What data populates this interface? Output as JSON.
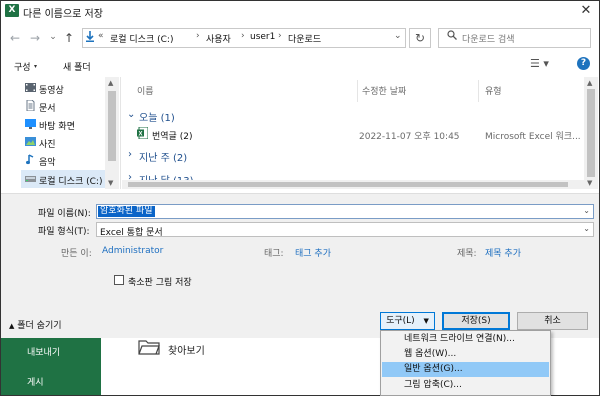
{
  "window": {
    "title": "다른 이름으로 저장",
    "app_icon": "X",
    "close_glyph": "✕"
  },
  "nav": {
    "back": "←",
    "forward": "→",
    "dropdown": "⌄",
    "up": "↑",
    "addr_prefix": "«",
    "breadcrumbs": [
      "로컬 디스크 (C:)",
      "사용자",
      "user1",
      "다운로드"
    ],
    "sep": "›",
    "refresh": "↻",
    "search_placeholder": "다운로드 검색"
  },
  "toolbar": {
    "organize": "구성",
    "new_folder": "새 폴더",
    "view_glyph": "☰ ▾",
    "help": "?"
  },
  "sidebar": {
    "items": [
      {
        "label": "동영상",
        "icon": "video-icon"
      },
      {
        "label": "문서",
        "icon": "document-icon"
      },
      {
        "label": "바탕 화면",
        "icon": "desktop-icon"
      },
      {
        "label": "사진",
        "icon": "picture-icon"
      },
      {
        "label": "음악",
        "icon": "music-icon"
      },
      {
        "label": "로컬 디스크 (C:)",
        "icon": "drive-icon"
      }
    ]
  },
  "filelist": {
    "columns": [
      "이름",
      "수정한 날짜",
      "유형"
    ],
    "groups": [
      {
        "label": "오늘 (1)",
        "expanded": true
      },
      {
        "label": "지난 주 (2)",
        "expanded": false
      },
      {
        "label": "지난 달 (13)",
        "expanded": false
      }
    ],
    "files": [
      {
        "name": "번역글 (2)",
        "modified": "2022-11-07 오후 10:45",
        "type": "Microsoft Excel 워크..."
      }
    ]
  },
  "form": {
    "filename_label": "파일 이름(N):",
    "filename_value": "암호화된 파일",
    "filetype_label": "파일 형식(T):",
    "filetype_value": "Excel 통합 문서",
    "author_label": "만든 이:",
    "author_value": "Administrator",
    "tags_label": "태그:",
    "tags_value": "태그 추가",
    "title_label": "제목:",
    "title_value": "제목 추가",
    "thumbnail_label": "축소판 그림 저장",
    "thumbnail_checked": false,
    "hide_folders": "폴더 숨기기"
  },
  "buttons": {
    "tools": "도구(L)",
    "tools_arrow": "▼",
    "save": "저장(S)",
    "cancel": "취소"
  },
  "tools_menu": {
    "items": [
      {
        "label": "네트워크 드라이브 연결(N)...",
        "highlighted": false
      },
      {
        "label": "웹 옵션(W)...",
        "highlighted": false
      },
      {
        "label": "일반 옵션(G)...",
        "highlighted": true
      },
      {
        "label": "그림 압축(C)...",
        "highlighted": false
      }
    ]
  },
  "backstage": {
    "items": [
      "내보내기",
      "게시"
    ],
    "browse": "찾아보기",
    "accent": "#1f7244"
  }
}
